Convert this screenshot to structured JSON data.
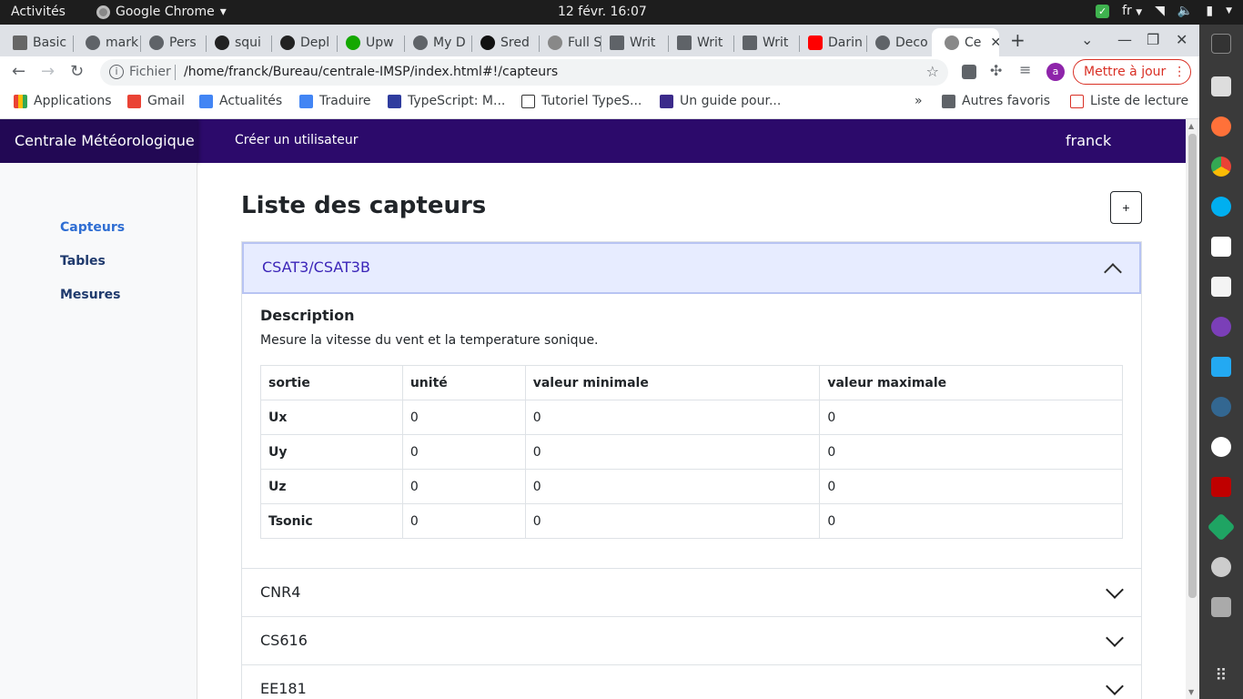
{
  "system": {
    "activities": "Activités",
    "app_name": "Google Chrome",
    "clock": "12 févr.  16:07",
    "lang": "fr"
  },
  "tabs": [
    {
      "label": "Basic"
    },
    {
      "label": "mark"
    },
    {
      "label": "Pers"
    },
    {
      "label": "squi"
    },
    {
      "label": "Depl"
    },
    {
      "label": "Upw"
    },
    {
      "label": "My D"
    },
    {
      "label": "Sred"
    },
    {
      "label": "Full S"
    },
    {
      "label": "Writ"
    },
    {
      "label": "Writ"
    },
    {
      "label": "Writ"
    },
    {
      "label": "Darin"
    },
    {
      "label": "Deco"
    },
    {
      "label": "Ce",
      "active": true
    }
  ],
  "toolbar": {
    "protocol": "Fichier",
    "url": "/home/franck/Bureau/centrale-IMSP/index.html#!/capteurs",
    "avatar_letter": "a",
    "update_label": "Mettre à jour"
  },
  "bookmarks": [
    {
      "label": "Applications"
    },
    {
      "label": "Gmail"
    },
    {
      "label": "Actualités"
    },
    {
      "label": "Traduire"
    },
    {
      "label": "TypeScript: M..."
    },
    {
      "label": "Tutoriel TypeS..."
    },
    {
      "label": "Un guide pour..."
    }
  ],
  "bookmarks_right": {
    "overflow": "»",
    "other": "Autres favoris",
    "reading": "Liste de lecture"
  },
  "navbar": {
    "brand": "Centrale Météorologique",
    "create_user": "Créer un utilisateur",
    "user": "franck"
  },
  "sidebar": {
    "items": [
      {
        "label": "Capteurs",
        "active": true
      },
      {
        "label": "Tables"
      },
      {
        "label": "Mesures"
      }
    ]
  },
  "main": {
    "title": "Liste des capteurs",
    "add_label": "+"
  },
  "sensors": [
    {
      "name": "CSAT3/CSAT3B",
      "open": true,
      "description_heading": "Description",
      "description": "Mesure la vitesse du vent et la temperature sonique.",
      "columns": [
        "sortie",
        "unité",
        "valeur minimale",
        "valeur maximale"
      ],
      "rows": [
        [
          "Ux",
          "0",
          "0",
          "0"
        ],
        [
          "Uy",
          "0",
          "0",
          "0"
        ],
        [
          "Uz",
          "0",
          "0",
          "0"
        ],
        [
          "Tsonic",
          "0",
          "0",
          "0"
        ]
      ]
    },
    {
      "name": "CNR4",
      "open": false
    },
    {
      "name": "CS616",
      "open": false
    },
    {
      "name": "EE181",
      "open": false
    }
  ],
  "colors": {
    "navbar": "#2c0a6b",
    "brand": "#220854",
    "accent": "#3b25b8",
    "update": "#d93025"
  }
}
